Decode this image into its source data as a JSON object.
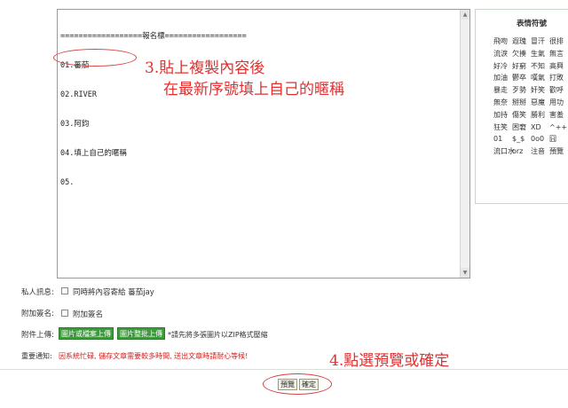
{
  "editor": {
    "lines": [
      "==================報名標==================",
      "01.蕃茄",
      "02.RIVER",
      "03.阿鈞",
      "04.填上自己的暱稱",
      "05."
    ]
  },
  "annotations": {
    "step3_line1": "3.貼上複製內容後",
    "step3_line2": "在最新序號填上自己的暱稱",
    "step4": "4.點選預覽或確定"
  },
  "emoji_panel": {
    "title": "表情符號",
    "rows": [
      [
        "飛吻",
        "遐瑰",
        "冒汗",
        "很排"
      ],
      [
        "流淚",
        "欠揍",
        "生氣",
        "無言"
      ],
      [
        "好冷",
        "好窮",
        "不知",
        "高興"
      ],
      [
        "加油",
        "鬱卒",
        "嘆氣",
        "打敗"
      ],
      [
        "暴走",
        "歹勢",
        "奸笑",
        "歡呼"
      ],
      [
        "無奈",
        "掰掰",
        "惡魔",
        "用功"
      ],
      [
        "加持",
        "傷笑",
        "勝利",
        "害羞"
      ],
      [
        "狂笑",
        "困窘",
        "XD",
        "^++^"
      ],
      [
        "01",
        "$_$",
        "0o0",
        "囧"
      ],
      [
        "流口水",
        "orz",
        "注音",
        "預覽"
      ]
    ]
  },
  "private_msg": {
    "label": "私人訊息:",
    "checkbox_label": "同時將內容寄給 蕃茄jay"
  },
  "signature": {
    "label": "附加簽名:",
    "checkbox_label": "附加簽名"
  },
  "attachment": {
    "label": "附件上傳:",
    "btn_file": "圖片或檔案上傳",
    "btn_batch": "圖片整批上傳",
    "hint": "*請先將多張圖片以ZIP格式壓縮"
  },
  "notice": {
    "label": "重要通知:",
    "text": "因系統忙碌, 儲存文章需要較多時間, 送出文章時請耐心等候!"
  },
  "actions": {
    "preview": "預覽",
    "confirm": "確定"
  },
  "colors": {
    "annotation_red": "#e03030",
    "button_green": "#3c9c3c"
  }
}
